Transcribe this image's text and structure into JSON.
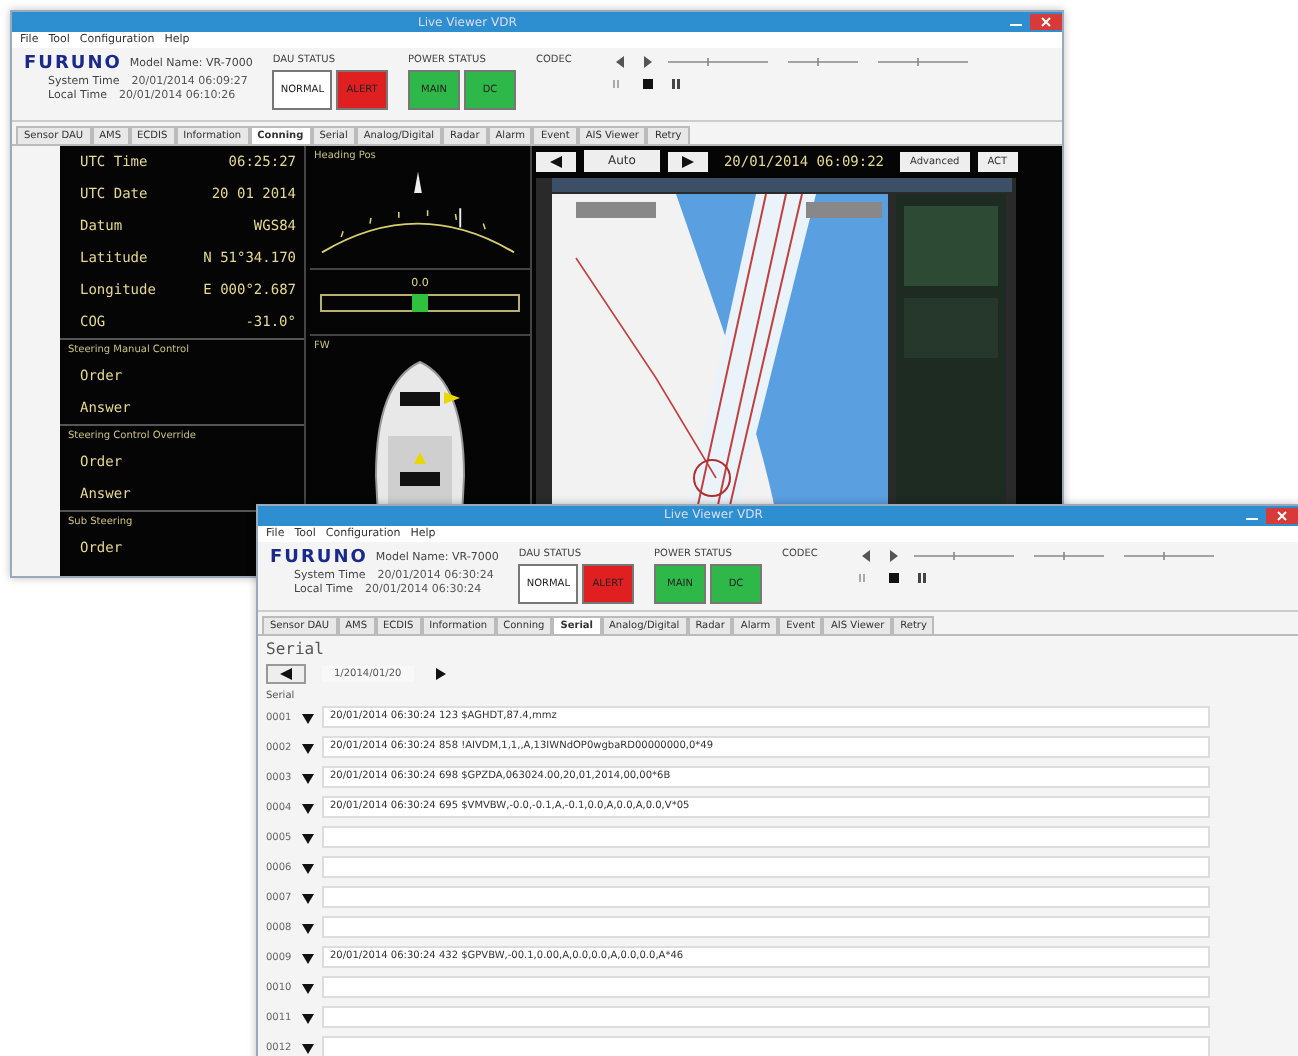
{
  "windows": [
    {
      "kind": "conning",
      "title": "Live Viewer VDR",
      "menu": [
        "File",
        "Tool",
        "Configuration",
        "Help"
      ],
      "logo": "FURUNO",
      "model": "Model Name: VR-7000",
      "times": [
        {
          "label": "System Time",
          "value": "20/01/2014 06:09:27"
        },
        {
          "label": "Local Time",
          "value": "20/01/2014 06:10:26"
        }
      ],
      "status_groups": [
        {
          "label": "DAU STATUS",
          "lights": [
            {
              "label": "NORMAL",
              "color": "#ffffff"
            },
            {
              "label": "ALERT",
              "color": "#e02020"
            }
          ]
        },
        {
          "label": "POWER STATUS",
          "lights": [
            {
              "label": "MAIN",
              "color": "#2fb84a"
            },
            {
              "label": "DC",
              "color": "#2fb84a"
            }
          ]
        }
      ],
      "codec": "CODEC",
      "tabs": [
        {
          "label": "Sensor DAU",
          "selected": false
        },
        {
          "label": "AMS",
          "selected": false
        },
        {
          "label": "ECDIS",
          "selected": false
        },
        {
          "label": "Information",
          "selected": false
        },
        {
          "label": "Conning",
          "selected": true
        },
        {
          "label": "Serial",
          "selected": false
        },
        {
          "label": "Analog/Digital",
          "selected": false
        },
        {
          "label": "Radar",
          "selected": false
        },
        {
          "label": "Alarm",
          "selected": false
        },
        {
          "label": "Event",
          "selected": false
        },
        {
          "label": "AIS Viewer",
          "selected": false
        },
        {
          "label": "Retry",
          "selected": false
        }
      ],
      "conning": {
        "readouts": [
          {
            "label": "UTC Time",
            "value": "06:25:27"
          },
          {
            "label": "UTC Date",
            "value": "20 01 2014"
          },
          {
            "label": "Datum",
            "value": "WGS84"
          },
          {
            "label": "Latitude",
            "value": "N 51°34.170"
          },
          {
            "label": "Longitude",
            "value": "E 000°2.687"
          },
          {
            "label": "COG",
            "value": "-31.0°"
          }
        ],
        "sections": [
          {
            "title": "Steering Manual Control",
            "rows": [
              "Order",
              "Answer"
            ]
          },
          {
            "title": "Steering Control Override",
            "rows": [
              "Order",
              "Answer"
            ]
          },
          {
            "title": "Sub Steering",
            "rows": [
              "Order"
            ]
          }
        ],
        "heading_title": "Heading Pos",
        "rot": {
          "value": "0.0",
          "level": 0.5
        },
        "ship_title": "FW",
        "viewer": {
          "mode": "Auto",
          "time": "20/01/2014 06:09:22",
          "buttons": [
            "Advanced",
            "ACT"
          ]
        }
      }
    },
    {
      "kind": "serial",
      "title": "Live Viewer VDR",
      "menu": [
        "File",
        "Tool",
        "Configuration",
        "Help"
      ],
      "logo": "FURUNO",
      "model": "Model Name: VR-7000",
      "times": [
        {
          "label": "System Time",
          "value": "20/01/2014 06:30:24"
        },
        {
          "label": "Local Time",
          "value": "20/01/2014 06:30:24"
        }
      ],
      "status_groups": [
        {
          "label": "DAU STATUS",
          "lights": [
            {
              "label": "NORMAL",
              "color": "#ffffff"
            },
            {
              "label": "ALERT",
              "color": "#e02020"
            }
          ]
        },
        {
          "label": "POWER STATUS",
          "lights": [
            {
              "label": "MAIN",
              "color": "#2fb84a"
            },
            {
              "label": "DC",
              "color": "#2fb84a"
            }
          ]
        }
      ],
      "codec": "CODEC",
      "tabs": [
        {
          "label": "Sensor DAU",
          "selected": false
        },
        {
          "label": "AMS",
          "selected": false
        },
        {
          "label": "ECDIS",
          "selected": false
        },
        {
          "label": "Information",
          "selected": false
        },
        {
          "label": "Conning",
          "selected": false
        },
        {
          "label": "Serial",
          "selected": true
        },
        {
          "label": "Analog/Digital",
          "selected": false
        },
        {
          "label": "Radar",
          "selected": false
        },
        {
          "label": "Alarm",
          "selected": false
        },
        {
          "label": "Event",
          "selected": false
        },
        {
          "label": "AIS Viewer",
          "selected": false
        },
        {
          "label": "Retry",
          "selected": false
        }
      ],
      "serial": {
        "heading": "Serial",
        "nav_date": "1/2014/01/20",
        "column_label": "Serial",
        "rows": [
          {
            "index": "0001",
            "text": "20/01/2014 06:30:24 123 $AGHDT,87.4,mmz"
          },
          {
            "index": "0002",
            "text": "20/01/2014 06:30:24 858 !AIVDM,1,1,,A,13IWNdOP0wgbaRD00000000,0*49"
          },
          {
            "index": "0003",
            "text": "20/01/2014 06:30:24 698 $GPZDA,063024.00,20,01,2014,00,00*6B"
          },
          {
            "index": "0004",
            "text": "20/01/2014 06:30:24 695 $VMVBW,-0.0,-0.1,A,-0.1,0.0,A,0.0,A,0.0,V*05"
          },
          {
            "index": "0005",
            "text": ""
          },
          {
            "index": "0006",
            "text": ""
          },
          {
            "index": "0007",
            "text": ""
          },
          {
            "index": "0008",
            "text": ""
          },
          {
            "index": "0009",
            "text": "20/01/2014 06:30:24 432 $GPVBW,-00.1,0.00,A,0.0,0.0,A,0.0,0.0,A*46"
          },
          {
            "index": "0010",
            "text": ""
          },
          {
            "index": "0011",
            "text": ""
          },
          {
            "index": "0012",
            "text": ""
          }
        ]
      }
    }
  ]
}
